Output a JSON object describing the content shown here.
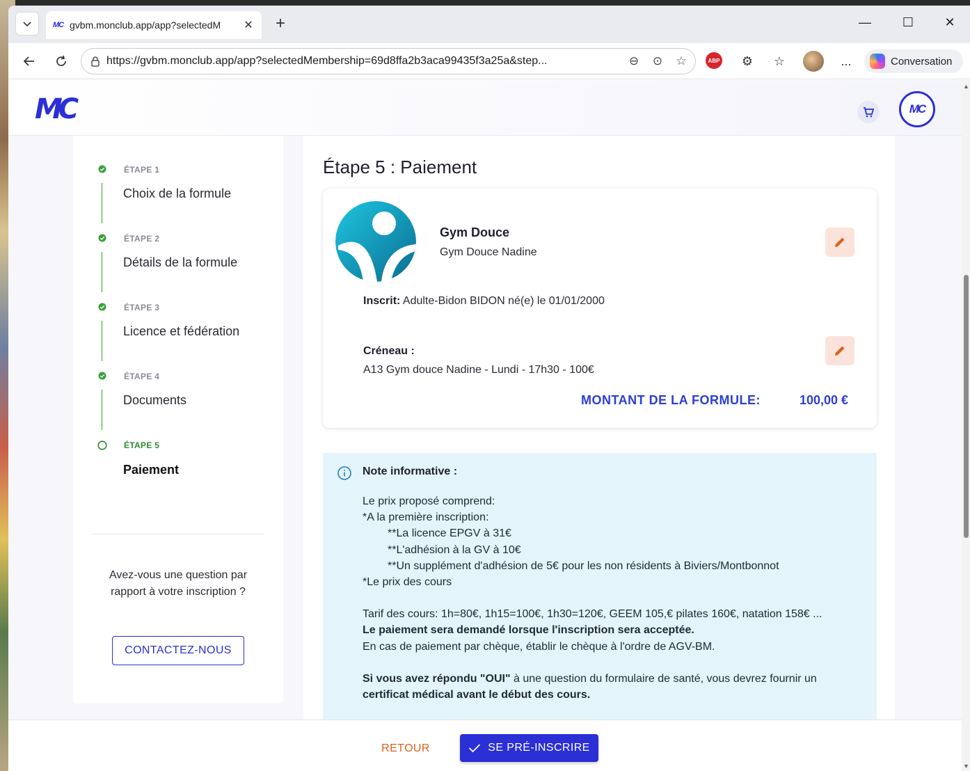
{
  "browser": {
    "tab_title": "gvbm.monclub.app/app?selectedM",
    "tab_favicon": "MC",
    "new_tab_glyph": "+",
    "url": "https://gvbm.monclub.app/app?selectedMembership=69d8ffa2b3aca99435f3a25a&step...",
    "adblock_label": "ABP",
    "more_label": "...",
    "copilot_label": "Conversation"
  },
  "app": {
    "logo": "MC",
    "profile_logo": "MC",
    "accent": "#2b2fd6"
  },
  "stepper": {
    "steps": [
      {
        "tag": "ÉTAPE 1",
        "label": "Choix de la formule",
        "status": "done"
      },
      {
        "tag": "ÉTAPE 2",
        "label": "Détails de la formule",
        "status": "done"
      },
      {
        "tag": "ÉTAPE 3",
        "label": "Licence et fédération",
        "status": "done"
      },
      {
        "tag": "ÉTAPE 4",
        "label": "Documents",
        "status": "done"
      },
      {
        "tag": "ÉTAPE 5",
        "label": "Paiement",
        "status": "current"
      }
    ],
    "question": "Avez-vous une question par rapport à votre inscription ?",
    "contact_label": "CONTACTEZ-NOUS"
  },
  "main": {
    "title": "Étape 5 : Paiement",
    "summary": {
      "activity_name": "Gym Douce",
      "activity_sub": "Gym Douce Nadine",
      "inscrit_label": "Inscrit:",
      "inscrit_value": "Adulte-Bidon BIDON né(e) le 01/01/2000",
      "creneau_label": "Créneau :",
      "creneau_value": "A13 Gym douce Nadine - Lundi - 17h30 - 100€",
      "montant_label": "MONTANT DE LA FORMULE:",
      "montant_value": "100,00 €"
    },
    "note": {
      "title": "Note informative :",
      "line1": "Le prix proposé comprend:",
      "line2": "*A la première inscription:",
      "line3": "**La licence EPGV à 31€",
      "line4": "**L'adhésion à la GV à 10€",
      "line5": "**Un supplément d'adhésion de 5€ pour les non résidents à Biviers/Montbonnot",
      "line6": "*Le prix des cours",
      "line7": "Tarif des cours: 1h=80€, 1h15=100€, 1h30=120€, GEEM 105,€ pilates 160€, natation 158€ ...",
      "line8": "Le paiement sera demandé lorsque l'inscription sera acceptée.",
      "line9": "En cas de paiement par chèque, établir le chèque à l'ordre de AGV-BM.",
      "line10_bold": "Si vous avez répondu \"OUI\"",
      "line10_rest": " à une question du formulaire de santé, vous devrez fournir un",
      "line11": "certificat médical avant le début des cours."
    }
  },
  "footer": {
    "back_label": "RETOUR",
    "submit_label": "SE PRÉ-INSCRIRE"
  }
}
